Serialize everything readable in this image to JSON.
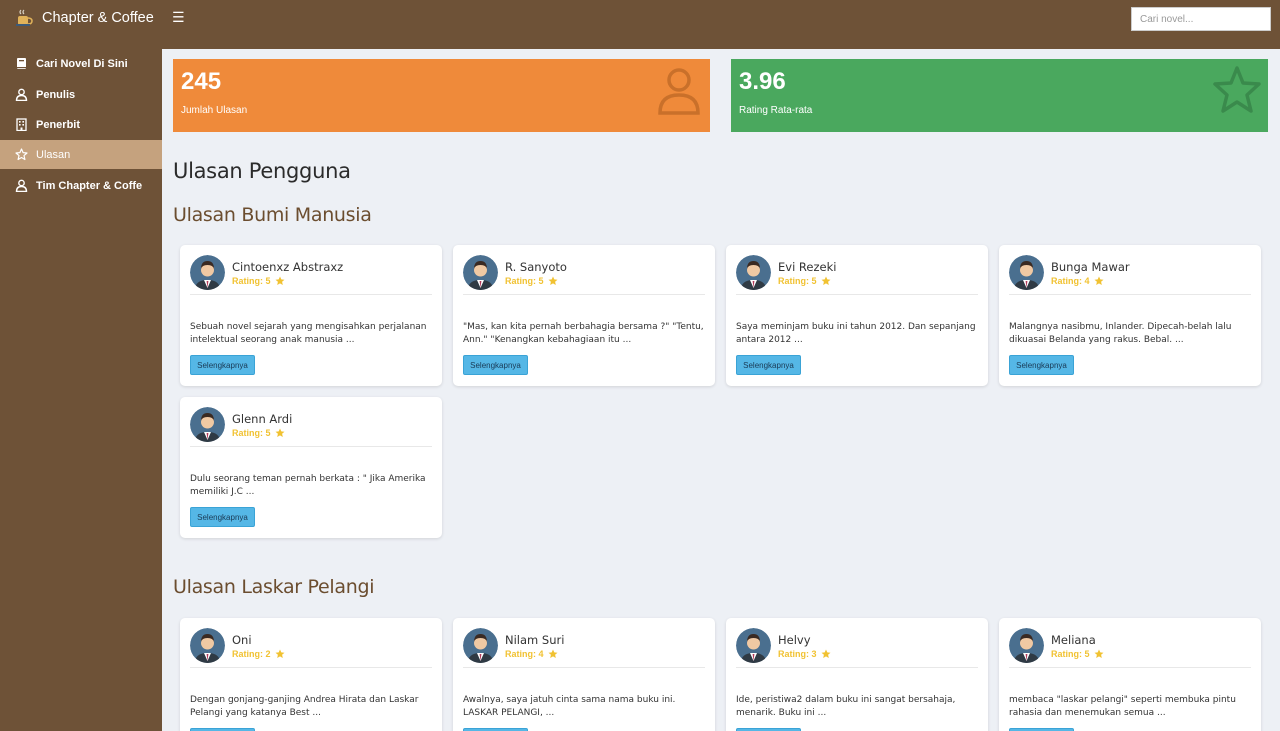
{
  "brand": {
    "name": "Chapter & Coffee"
  },
  "search": {
    "placeholder": "Cari novel..."
  },
  "sidebar": {
    "items": [
      {
        "label": "Cari Novel Di Sini",
        "icon": "book-icon"
      },
      {
        "label": "Penulis",
        "icon": "user-icon"
      },
      {
        "label": "Penerbit",
        "icon": "building-icon"
      },
      {
        "label": "Ulasan",
        "icon": "star-icon"
      },
      {
        "label": "Tim Chapter & Coffe",
        "icon": "user-icon"
      }
    ]
  },
  "stats": {
    "reviews": {
      "value": "245",
      "label": "Jumlah Ulasan",
      "color": "#ef8a3a"
    },
    "rating": {
      "value": "3.96",
      "label": "Rating Rata-rata",
      "color": "#4aa85e"
    }
  },
  "page_title": "Ulasan Pengguna",
  "button_label": "Selengkapnya",
  "sections": [
    {
      "title": "Ulasan Bumi Manusia",
      "reviews": [
        {
          "name": "Cintoenxz Abstraxz",
          "rating": "Rating: 5",
          "text": "Sebuah novel sejarah yang mengisahkan perjalanan intelektual seorang anak manusia ..."
        },
        {
          "name": "R. Sanyoto",
          "rating": "Rating: 5",
          "text": "\"Mas, kan kita pernah berbahagia bersama ?\" \"Tentu, Ann.\" \"Kenangkan kebahagiaan itu ..."
        },
        {
          "name": "Evi Rezeki",
          "rating": "Rating: 5",
          "text": "Saya meminjam buku ini tahun 2012. Dan sepanjang antara 2012 ..."
        },
        {
          "name": "Bunga Mawar",
          "rating": "Rating: 4",
          "text": "Malangnya nasibmu, Inlander. Dipecah-belah lalu dikuasai Belanda yang rakus. Bebal. ..."
        },
        {
          "name": "Glenn Ardi",
          "rating": "Rating: 5",
          "text": "Dulu seorang teman pernah berkata : \" Jika Amerika memiliki J.C ..."
        }
      ]
    },
    {
      "title": "Ulasan Laskar Pelangi",
      "reviews": [
        {
          "name": "Oni",
          "rating": "Rating: 2",
          "text": "Dengan gonjang-ganjing Andrea Hirata dan Laskar Pelangi yang katanya Best ..."
        },
        {
          "name": "Nilam Suri",
          "rating": "Rating: 4",
          "text": "Awalnya, saya jatuh cinta sama nama buku ini. LASKAR PELANGI, ..."
        },
        {
          "name": "Helvy",
          "rating": "Rating: 3",
          "text": "Ide, peristiwa2 dalam buku ini sangat bersahaja, menarik. Buku ini ..."
        },
        {
          "name": "Meliana",
          "rating": "Rating: 5",
          "text": "membaca \"laskar pelangi\" seperti membuka pintu rahasia dan menemukan semua ..."
        }
      ]
    }
  ]
}
